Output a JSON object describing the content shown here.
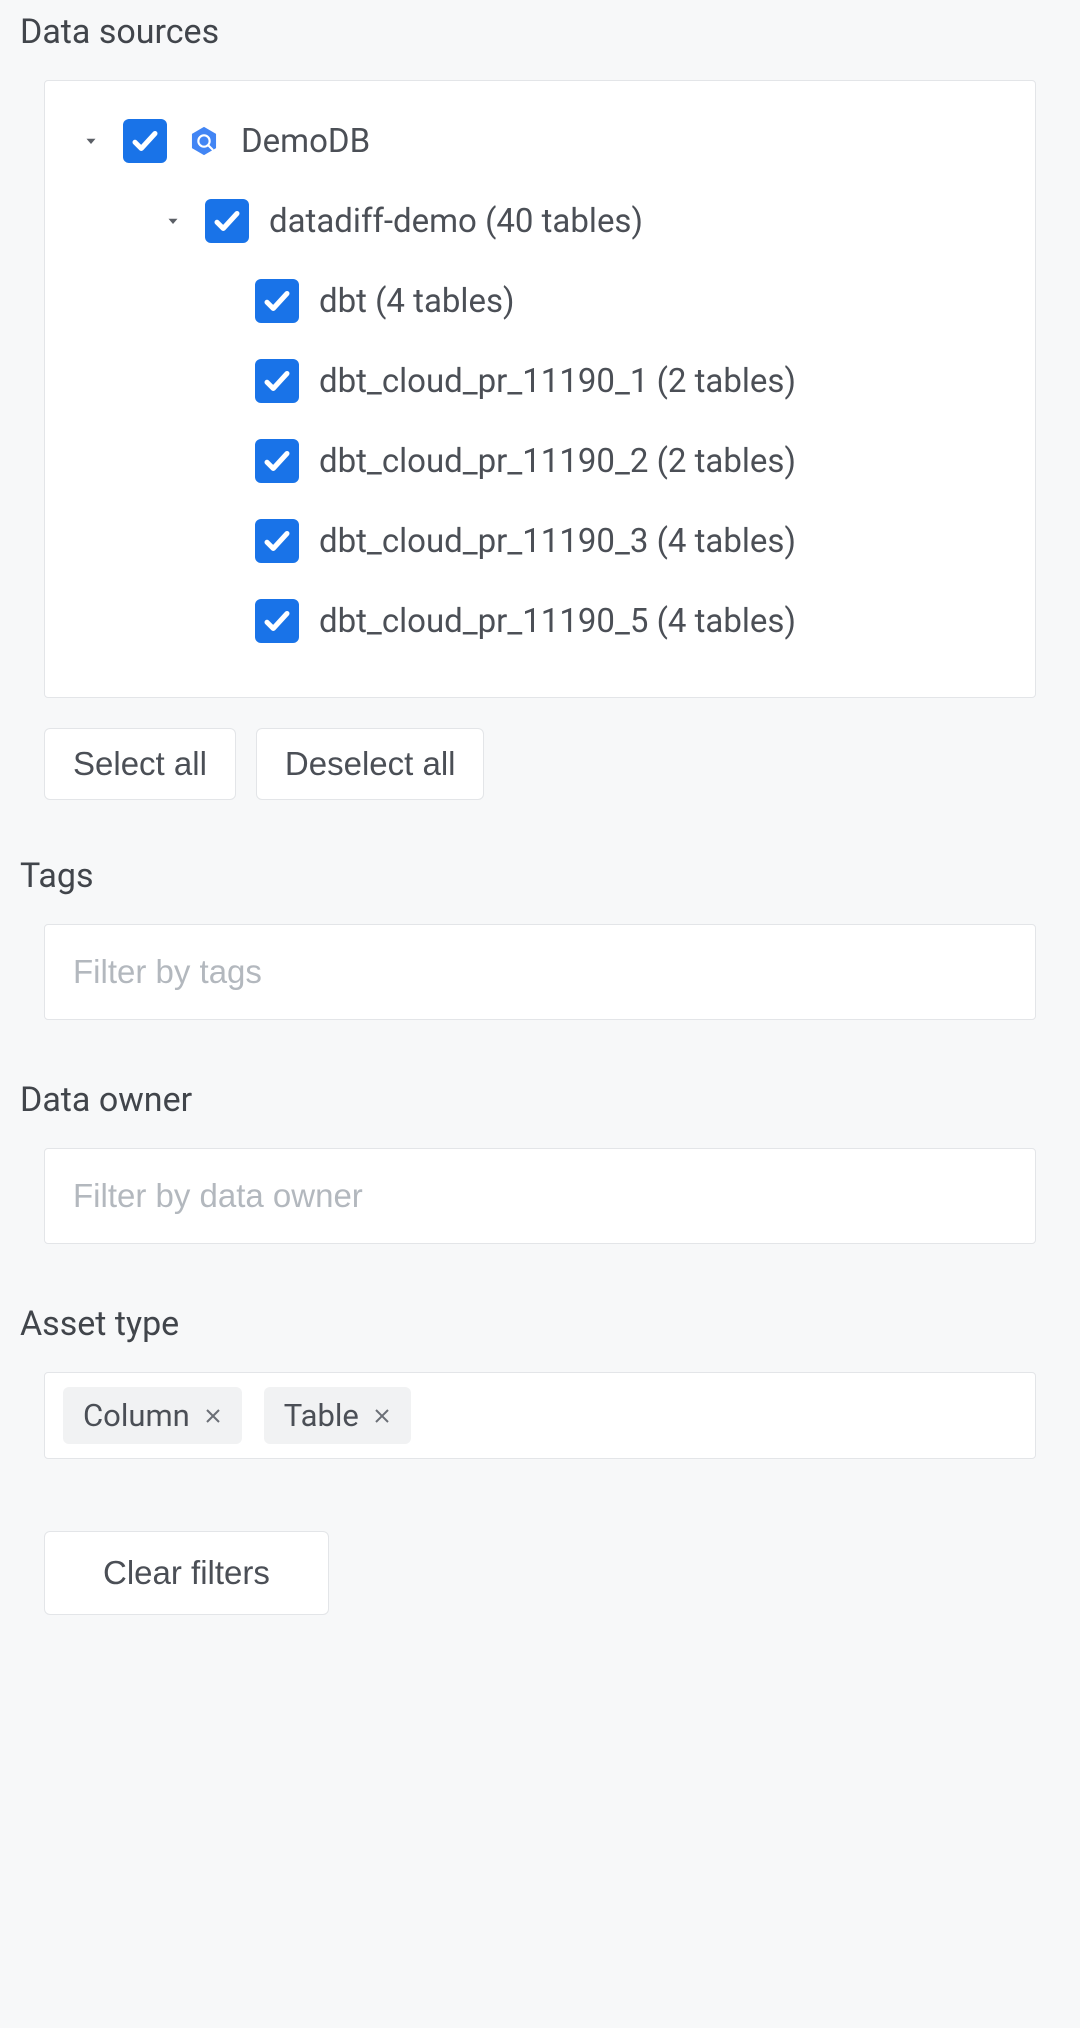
{
  "sections": {
    "data_sources": {
      "title": "Data sources",
      "select_all": "Select all",
      "deselect_all": "Deselect all"
    },
    "tags": {
      "title": "Tags",
      "placeholder": "Filter by tags"
    },
    "data_owner": {
      "title": "Data owner",
      "placeholder": "Filter by data owner"
    },
    "asset_type": {
      "title": "Asset type",
      "chips": [
        {
          "label": "Column"
        },
        {
          "label": "Table"
        }
      ]
    },
    "clear_filters": "Clear filters"
  },
  "tree": {
    "root": {
      "label": "DemoDB",
      "expanded": true,
      "checked": true,
      "children": [
        {
          "label": "datadiff-demo (40 tables)",
          "expanded": true,
          "checked": true,
          "children": [
            {
              "label": "dbt (4 tables)",
              "checked": true
            },
            {
              "label": "dbt_cloud_pr_11190_1 (2 tables)",
              "checked": true
            },
            {
              "label": "dbt_cloud_pr_11190_2 (2 tables)",
              "checked": true
            },
            {
              "label": "dbt_cloud_pr_11190_3 (4 tables)",
              "checked": true
            },
            {
              "label": "dbt_cloud_pr_11190_5 (4 tables)",
              "checked": true
            }
          ]
        }
      ]
    }
  },
  "colors": {
    "checkbox_bg": "#1973e8",
    "db_icon": "#1a73e8"
  }
}
